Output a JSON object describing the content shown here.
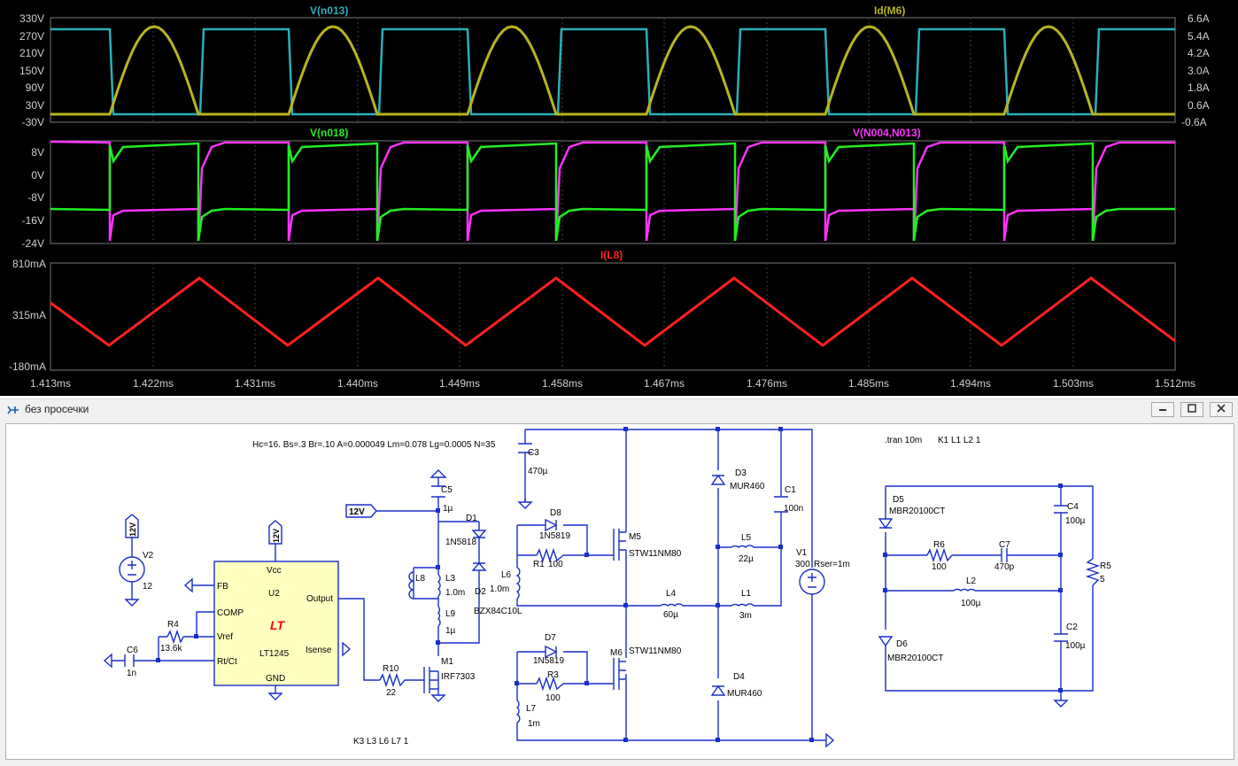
{
  "waveform": {
    "pane1": {
      "left_label": "V(n013)",
      "right_label": "Id(M6)",
      "left_ticks": [
        "330V",
        "270V",
        "210V",
        "150V",
        "90V",
        "30V",
        "-30V"
      ],
      "right_ticks": [
        "6.6A",
        "5.4A",
        "4.2A",
        "3.0A",
        "1.8A",
        "0.6A",
        "-0.6A"
      ]
    },
    "pane2": {
      "left_label": "V(n018)",
      "right_label": "V(N004,N013)",
      "ticks": [
        "8V",
        "0V",
        "-8V",
        "-16V",
        "-24V"
      ]
    },
    "pane3": {
      "label": "I(L8)",
      "ticks": [
        "810mA",
        "315mA",
        "-180mA"
      ]
    },
    "x_ticks": [
      "1.413ms",
      "1.422ms",
      "1.431ms",
      "1.440ms",
      "1.449ms",
      "1.458ms",
      "1.467ms",
      "1.476ms",
      "1.485ms",
      "1.494ms",
      "1.503ms",
      "1.512ms"
    ],
    "colors": {
      "cyan": "#2ab0b8",
      "yellow": "#b8b420",
      "green": "#22ee22",
      "magenta": "#ff33ff",
      "red": "#ff2020",
      "grid": "#555555"
    }
  },
  "window": {
    "title": "без просечки",
    "min_icon": "minimize-icon",
    "max_icon": "maximize-icon",
    "close_icon": "close-icon"
  },
  "schematic": {
    "directive_core": "Hc=16. Bs=.3 Br=.10 A=0.000049 Lm=0.078 Lg=0.0005 N=35",
    "directive_tran": ".tran 10m",
    "directive_k1": "K1 L1 L2 1",
    "directive_k3": "K3 L3 L6 L7 1",
    "net_12v": "12V",
    "u2": {
      "name": "U2",
      "part": "LT1245",
      "logo": "LT",
      "pins": {
        "vcc": "Vcc",
        "fb": "FB",
        "comp": "COMP",
        "vref": "Vref",
        "rtct": "Rt/Ct",
        "output": "Output",
        "isense": "Isense",
        "gnd": "GND"
      }
    },
    "v2": {
      "name": "V2",
      "value": "12"
    },
    "r4": {
      "name": "R4",
      "value": "13.6k"
    },
    "c6": {
      "name": "C6",
      "value": "1n"
    },
    "r10": {
      "name": "R10",
      "value": "22"
    },
    "m1": {
      "name": "M1",
      "part": "IRF7303"
    },
    "c5": {
      "name": "C5",
      "value": "1µ"
    },
    "d1": {
      "name": "D1",
      "part": "1N5818"
    },
    "d2": {
      "name": "D2",
      "part": "BZX84C10L"
    },
    "l8": {
      "name": "L8"
    },
    "l3": {
      "name": "L3",
      "value": "1.0m"
    },
    "l9": {
      "name": "L9",
      "value": "1µ"
    },
    "c3": {
      "name": "C3",
      "value": "470µ"
    },
    "d8": {
      "name": "D8",
      "part": "1N5819"
    },
    "r1": {
      "name": "R1",
      "value": "100"
    },
    "l6": {
      "name": "L6",
      "value": "1.0m"
    },
    "m5": {
      "name": "M5",
      "part": "STW11NM80"
    },
    "d7": {
      "name": "D7",
      "part": "1N5819"
    },
    "r3": {
      "name": "R3",
      "value": "100"
    },
    "l7": {
      "name": "L7",
      "value": "1m"
    },
    "m6": {
      "name": "M6",
      "part": "STW11NM80"
    },
    "l4": {
      "name": "L4",
      "value": "60µ"
    },
    "d3": {
      "name": "D3",
      "part": "MUR460"
    },
    "d4": {
      "name": "D4",
      "part": "MUR460"
    },
    "l5": {
      "name": "L5",
      "value": "22µ"
    },
    "l1": {
      "name": "L1",
      "value": "3m"
    },
    "c1": {
      "name": "C1",
      "value": "100n"
    },
    "v1": {
      "name": "V1",
      "value": "300",
      "rser": "Rser=1m"
    },
    "d5": {
      "name": "D5",
      "part": "MBR20100CT"
    },
    "d6": {
      "name": "D6",
      "part": "MBR20100CT"
    },
    "r6": {
      "name": "R6",
      "value": "100"
    },
    "c7": {
      "name": "C7",
      "value": "470p"
    },
    "l2": {
      "name": "L2",
      "value": "100µ"
    },
    "c4": {
      "name": "C4",
      "value": "100µ"
    },
    "c2": {
      "name": "C2",
      "value": "100µ"
    },
    "r5": {
      "name": "R5",
      "value": "5"
    }
  }
}
